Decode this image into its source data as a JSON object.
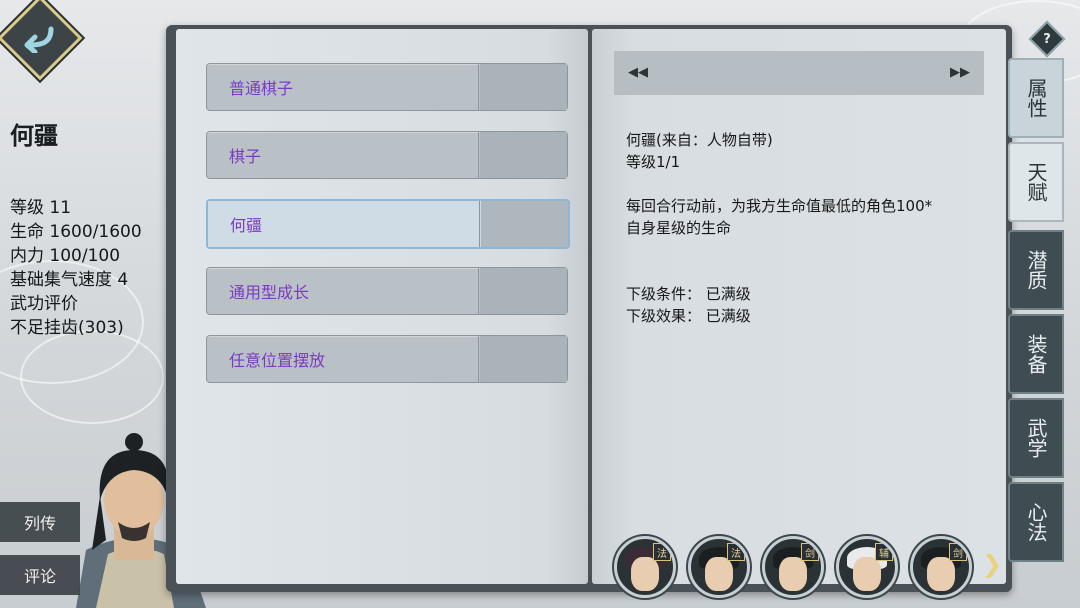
{
  "character": {
    "name": "何疆",
    "stats": [
      "等级 11",
      "生命 1600/1600",
      "内力 100/100",
      "基础集气速度 4",
      "武功评价",
      "不足挂齿(303)"
    ]
  },
  "side_buttons": {
    "biography": "列传",
    "comments": "评论"
  },
  "talent_list": [
    {
      "label": "普通棋子",
      "selected": false
    },
    {
      "label": "棋子",
      "selected": false
    },
    {
      "label": "何疆",
      "selected": true
    },
    {
      "label": "通用型成长",
      "selected": false
    },
    {
      "label": "任意位置摆放",
      "selected": false
    }
  ],
  "detail": {
    "title": "何疆(来自：人物自带)",
    "level": "等级1/1",
    "description_line1": "每回合行动前，为我方生命值最低的角色100*",
    "description_line2": "自身星级的生命",
    "next_condition": "下级条件：  已满级",
    "next_effect": "下级效果：  已满级"
  },
  "tabs": [
    {
      "label": "属性",
      "state": "semi"
    },
    {
      "label": "天赋",
      "state": "active"
    },
    {
      "label": "潜质",
      "state": "normal"
    },
    {
      "label": "装备",
      "state": "normal"
    },
    {
      "label": "武学",
      "state": "normal"
    },
    {
      "label": "心法",
      "state": "normal"
    }
  ],
  "help_label": "?",
  "team_avatars": [
    {
      "badge": "法"
    },
    {
      "badge": "法"
    },
    {
      "badge": "剑"
    },
    {
      "badge": "辅"
    },
    {
      "badge": "剑"
    }
  ],
  "icons": {
    "back": "back-arrow-icon",
    "prev": "prev-arrow-icon",
    "next": "next-arrow-icon",
    "help": "help-icon",
    "more": "chevron-right-icon"
  },
  "colors": {
    "talent_text": "#7b3bc2",
    "panel_dark": "#4a5257",
    "tab_dark": "#3f4c52",
    "accent_gold": "#d9c98a"
  }
}
